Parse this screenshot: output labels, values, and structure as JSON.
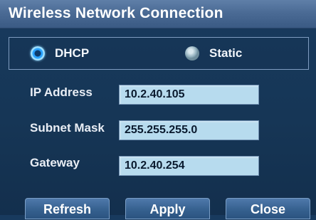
{
  "window": {
    "title": "Wireless Network Connection"
  },
  "mode": {
    "selected": "DHCP",
    "options": [
      {
        "label": "DHCP",
        "checked": true
      },
      {
        "label": "Static",
        "checked": false
      }
    ]
  },
  "fields": {
    "ip": {
      "label": "IP Address",
      "value": "10.2.40.105"
    },
    "subnet": {
      "label": "Subnet Mask",
      "value": "255.255.255.0"
    },
    "gateway": {
      "label": "Gateway",
      "value": "10.2.40.254"
    }
  },
  "buttons": {
    "refresh": "Refresh",
    "apply": "Apply",
    "close": "Close"
  },
  "icons": {
    "radio_on": "radio-selected-icon",
    "radio_off": "radio-unselected-icon"
  },
  "colors": {
    "accent": "#2aa3ff",
    "input_bg": "#b7dbee",
    "panel_bg": "#163656"
  }
}
